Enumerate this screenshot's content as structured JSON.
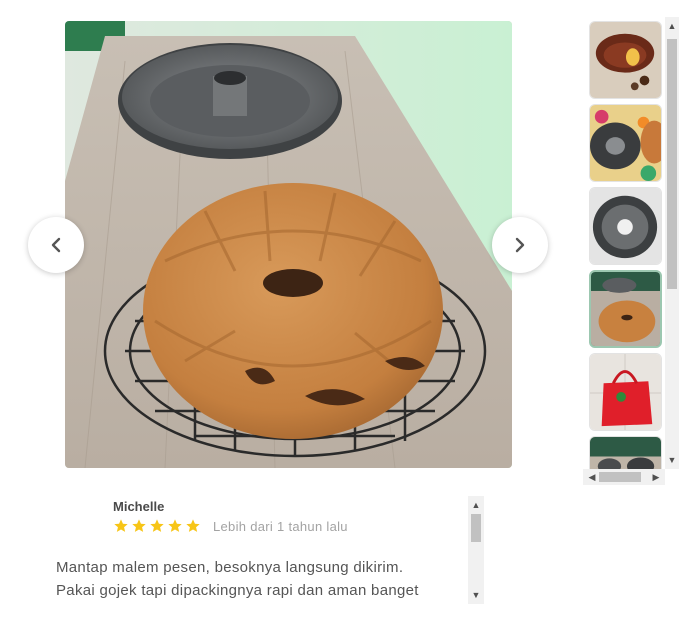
{
  "gallery": {
    "main_image": {
      "subject": "marble-bundt-cake-photo"
    },
    "prev_icon": "chevron-left-icon",
    "next_icon": "chevron-right-icon",
    "thumbnails": [
      {
        "subject": "chocolate-bundt-cake-photo"
      },
      {
        "subject": "bundt-pan-on-floral-cloth-photo"
      },
      {
        "subject": "bundt-pan-top-view-photo"
      },
      {
        "subject": "cake-on-rack-photo"
      },
      {
        "subject": "red-gift-bag-photo"
      },
      {
        "subject": "packaging-photo"
      }
    ],
    "thumbnail_selected_index": 3
  },
  "review": {
    "reviewer_name": "Michelle",
    "rating": 5,
    "rating_max": 5,
    "date": "Lebih dari 1 tahun lalu",
    "text_line1": "Mantap malem pesen, besoknya langsung dikirim.",
    "text_line2": "Pakai gojek tapi dipackingnya rapi dan aman banget"
  },
  "colors": {
    "star": "#f7c517",
    "reviewer_name": "#4a4a4a",
    "review_date": "#a3a3a3",
    "review_text": "#555555"
  }
}
